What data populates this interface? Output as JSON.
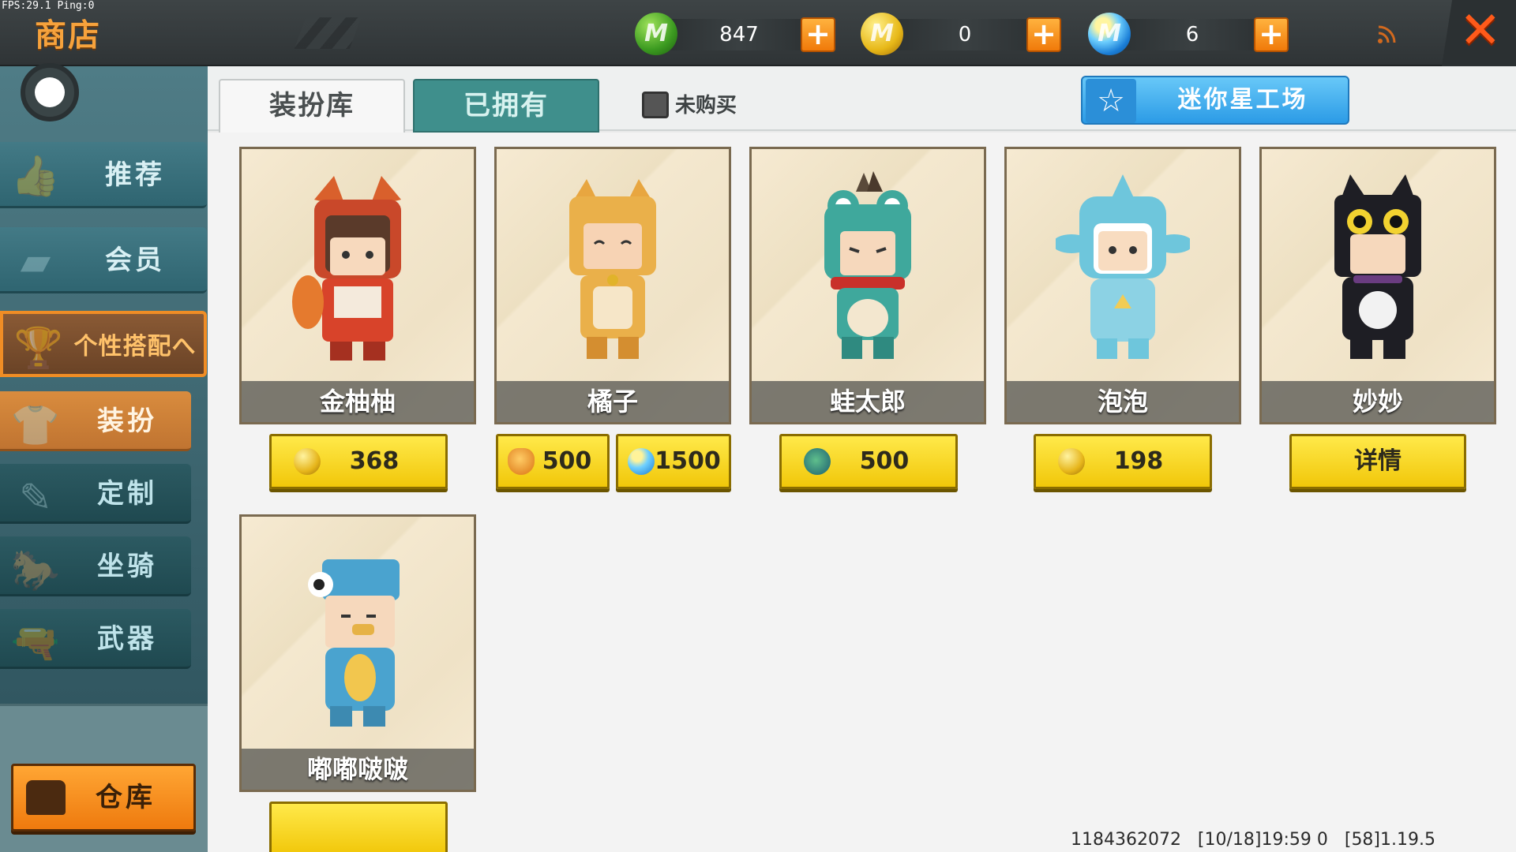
{
  "debug": {
    "fps_text": "FPS:29.1  Ping:0"
  },
  "header": {
    "title": "商店",
    "currencies": [
      {
        "icon": "green-gem-coin-icon",
        "value": "847"
      },
      {
        "icon": "gold-coin-icon",
        "value": "0"
      },
      {
        "icon": "mini-bean-coin-icon",
        "value": "6"
      }
    ],
    "plus_label": "+",
    "close_label": "✕"
  },
  "sidebar": {
    "items": [
      {
        "label": "推荐",
        "icon": "thumbs-up-icon"
      },
      {
        "label": "会员",
        "icon": "member-card-icon"
      },
      {
        "label": "个性搭配へ",
        "icon": "trophy-icon"
      },
      {
        "label": "装扮",
        "icon": "shirt-icon"
      },
      {
        "label": "定制",
        "icon": "pencil-icon"
      },
      {
        "label": "坐骑",
        "icon": "mount-icon"
      },
      {
        "label": "武器",
        "icon": "gun-icon"
      }
    ],
    "warehouse_label": "仓库"
  },
  "tabs": {
    "outfit_library": "装扮库",
    "owned": "已拥有",
    "unpurchased_label": "未购买",
    "workshop_label": "迷你星工场"
  },
  "skins": [
    {
      "name": "金柚柚",
      "prices": [
        {
          "currency": "gold",
          "amount": "368"
        }
      ]
    },
    {
      "name": "橘子",
      "prices": [
        {
          "currency": "cat-token",
          "amount": "500"
        },
        {
          "currency": "mini-bean",
          "amount": "1500"
        }
      ]
    },
    {
      "name": "蛙太郎",
      "prices": [
        {
          "currency": "frog-token",
          "amount": "500"
        }
      ]
    },
    {
      "name": "泡泡",
      "prices": [
        {
          "currency": "gold",
          "amount": "198"
        }
      ]
    },
    {
      "name": "妙妙",
      "detail_label": "详情"
    },
    {
      "name": "嘟嘟啵啵"
    }
  ],
  "footer": {
    "info": "1184362072   [10/18]19:59 0   [58]1.19.5"
  },
  "colors": {
    "accent_orange": "#f08d25",
    "teal": "#3f8f8c",
    "price_yellow": "#f1c70a",
    "workshop_blue": "#2b9be6"
  }
}
